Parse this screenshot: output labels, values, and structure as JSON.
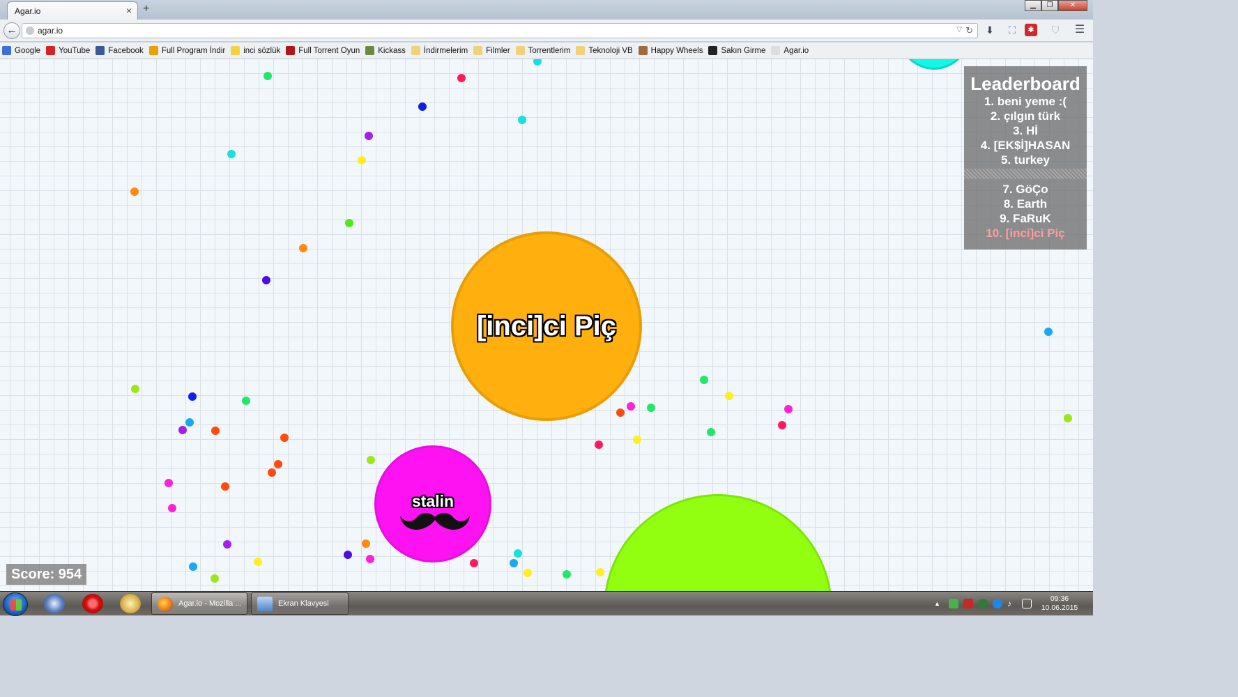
{
  "browser": {
    "tab_title": "Agar.io",
    "tab_close": "×",
    "new_tab": "+",
    "url": "agar.io",
    "bookmarks": [
      {
        "label": "Google",
        "color": "#3b6fd9"
      },
      {
        "label": "YouTube",
        "color": "#d62323"
      },
      {
        "label": "Facebook",
        "color": "#3b5998"
      },
      {
        "label": "Full Program İndir",
        "color": "#e8a200"
      },
      {
        "label": "inci sözlük",
        "color": "#f4d23e"
      },
      {
        "label": "Full Torrent Oyun",
        "color": "#b01818"
      },
      {
        "label": "Kickass",
        "color": "#6c8a3c"
      },
      {
        "label": "İndirmelerim",
        "color": "#f1d27a"
      },
      {
        "label": "Filmler",
        "color": "#f1d27a"
      },
      {
        "label": "Torrentlerim",
        "color": "#f1d27a"
      },
      {
        "label": "Teknoloji VB",
        "color": "#f1d27a"
      },
      {
        "label": "Happy Wheels",
        "color": "#a06a3a"
      },
      {
        "label": "Sakın Girme",
        "color": "#222222"
      },
      {
        "label": "Agar.io",
        "color": "#dddddd"
      }
    ]
  },
  "game": {
    "leaderboard": {
      "title": "Leaderboard",
      "top": [
        "1. beni yeme :(",
        "2. çılgın türk",
        "3. Hİ",
        "4. [EK$İ]HASAN",
        "5. turkey"
      ],
      "bottom": [
        "7. GöÇo",
        "8. Earth",
        "9. FaRuK"
      ],
      "self": "10. [inci]ci Piç"
    },
    "score_label": "Score: 954",
    "cells": [
      {
        "name": "[inci]ci Piç",
        "color": "#ffb00f"
      },
      {
        "name": "stalin",
        "color": "#ff12f1"
      },
      {
        "name": "",
        "color": "#92ff10"
      },
      {
        "name": "",
        "color": "#12f7e6"
      }
    ],
    "pellet_colors": [
      "#22e86a",
      "#ff1a5e",
      "#1020e8",
      "#16e0e0",
      "#a020ee",
      "#ffee20",
      "#ff8a10",
      "#50e818",
      "#4810e8",
      "#ff4a10",
      "#1aa8f0",
      "#ff20d8",
      "#9ae81a"
    ]
  },
  "taskbar": {
    "items": [
      "Agar.io - Mozilla ...",
      "Ekran Klavyesi"
    ],
    "time": "09:36",
    "date": "10.06.2015"
  }
}
